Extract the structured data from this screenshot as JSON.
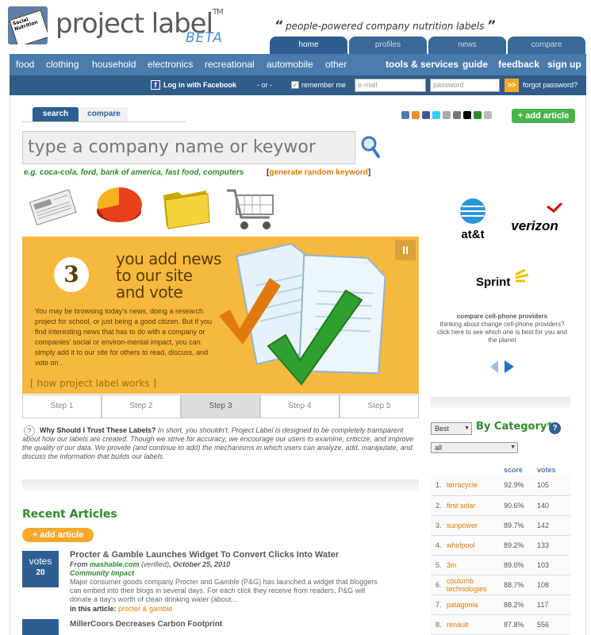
{
  "header": {
    "logo_text": "project label",
    "logo_tm": "TM",
    "logo_beta": "BETA",
    "logo_card_text": "Social Nutrition",
    "tagline": "people-powered company nutrition labels",
    "quote_open": "“",
    "quote_close": "”"
  },
  "top_tabs": [
    {
      "label": "home",
      "active": true
    },
    {
      "label": "profiles",
      "active": false
    },
    {
      "label": "news",
      "active": false
    },
    {
      "label": "compare",
      "active": false
    }
  ],
  "categories": [
    "food",
    "clothing",
    "household",
    "electronics",
    "recreational",
    "automobile",
    "other"
  ],
  "utility_nav": [
    "tools & services",
    "guide",
    "feedback",
    "sign up"
  ],
  "login": {
    "facebook_label": "Log in with Facebook",
    "or_label": "- or -",
    "remember_label": "remember me",
    "email_placeholder": "e-mail",
    "password_placeholder": "password",
    "go_label": ">>",
    "forgot_label": "forgot password?"
  },
  "search": {
    "tabs": [
      "search",
      "compare"
    ],
    "placeholder": "type a company name or keywor",
    "example": "e.g. coca-cola, ford, bank of america, fast food, computers",
    "random_bracket_open": "[",
    "random_label": "generate random keyword",
    "random_bracket_close": "]"
  },
  "social": {
    "add_article_label": "+ add article"
  },
  "hero": {
    "step_number": "3",
    "title_line1": "you add news",
    "title_line2": "to our site",
    "title_line3": "and vote",
    "body": "You may be browsing today's news, doing a research project for school, or just being a good citizen. But if you find interesting news that has to do with a company or companies' social or environ-mental impact, you can simply add it to our site for others to read, discuss, and vote on .",
    "footer": "[ how project label works ]",
    "pause_label": "II"
  },
  "steps": [
    {
      "label": "Step 1",
      "active": false
    },
    {
      "label": "Step 2",
      "active": false
    },
    {
      "label": "Step 3",
      "active": true
    },
    {
      "label": "Step 4",
      "active": false
    },
    {
      "label": "Step 5",
      "active": false
    }
  ],
  "trust": {
    "heading": "Why Should I Trust These Labels?",
    "body": "In short, you shouldn't. Project Label is designed to be completely transparent about how our labels are created. Though we strive for accuracy, we encourage our users to examine, criticize, and improve the quality of our data. We provide (and continue to add) the mechanisms in which users can analyze, add, manipulate, and discuss the information that builds our labels."
  },
  "carrier_panel": {
    "carriers": [
      "at&t",
      "verizon",
      "Sprint"
    ],
    "title": "compare cell-phone providers",
    "description": "thinking about change cell-phone providers? click here to see which one is best for you and the planet"
  },
  "by_category": {
    "sort_value": "Best",
    "title": "By Category*",
    "help_label": "?",
    "filter_value": "all",
    "headers": {
      "score": "score",
      "votes": "votes"
    },
    "rows": [
      {
        "rank": "1.",
        "name": "terracycle",
        "score": "92.9%",
        "votes": "105"
      },
      {
        "rank": "2.",
        "name": "first solar",
        "score": "90.6%",
        "votes": "140"
      },
      {
        "rank": "3.",
        "name": "sunpower",
        "score": "89.7%",
        "votes": "142"
      },
      {
        "rank": "4.",
        "name": "whirlpool",
        "score": "89.2%",
        "votes": "133"
      },
      {
        "rank": "5.",
        "name": "3m",
        "score": "89.0%",
        "votes": "103"
      },
      {
        "rank": "6.",
        "name": "coulomb technologies",
        "score": "88.7%",
        "votes": "108"
      },
      {
        "rank": "7.",
        "name": "patagonia",
        "score": "88.2%",
        "votes": "117"
      },
      {
        "rank": "8.",
        "name": "renault",
        "score": "87.8%",
        "votes": "556"
      }
    ]
  },
  "recent": {
    "title": "Recent Articles",
    "add_article_label": "+ add article",
    "articles": [
      {
        "votes_label": "votes",
        "votes": "20",
        "title": "Procter & Gamble Launches Widget To Convert Clicks Into Water",
        "from_prefix": "From",
        "source": "mashable.com",
        "verified": "(verified)",
        "date": ", October 25, 2010",
        "category": "Community Impact",
        "description": "Major consumer goods company Procter and Gamble (P&G) has launched a widget that bloggers can embed into their blogs in several days. For each click they receive from readers, P&G will donate a day's worth of clean drinking water (about...",
        "in_label": "in this article:",
        "in_company": "procter & gamble"
      },
      {
        "title": "MillerCoors Decreases Carbon Footprint"
      }
    ]
  },
  "colors": {
    "nav_blue": "#4a7bad",
    "dark_blue": "#2f5c88",
    "green": "#2d8b2d",
    "orange": "#e07a00",
    "hero_yellow": "#f6b83d"
  }
}
